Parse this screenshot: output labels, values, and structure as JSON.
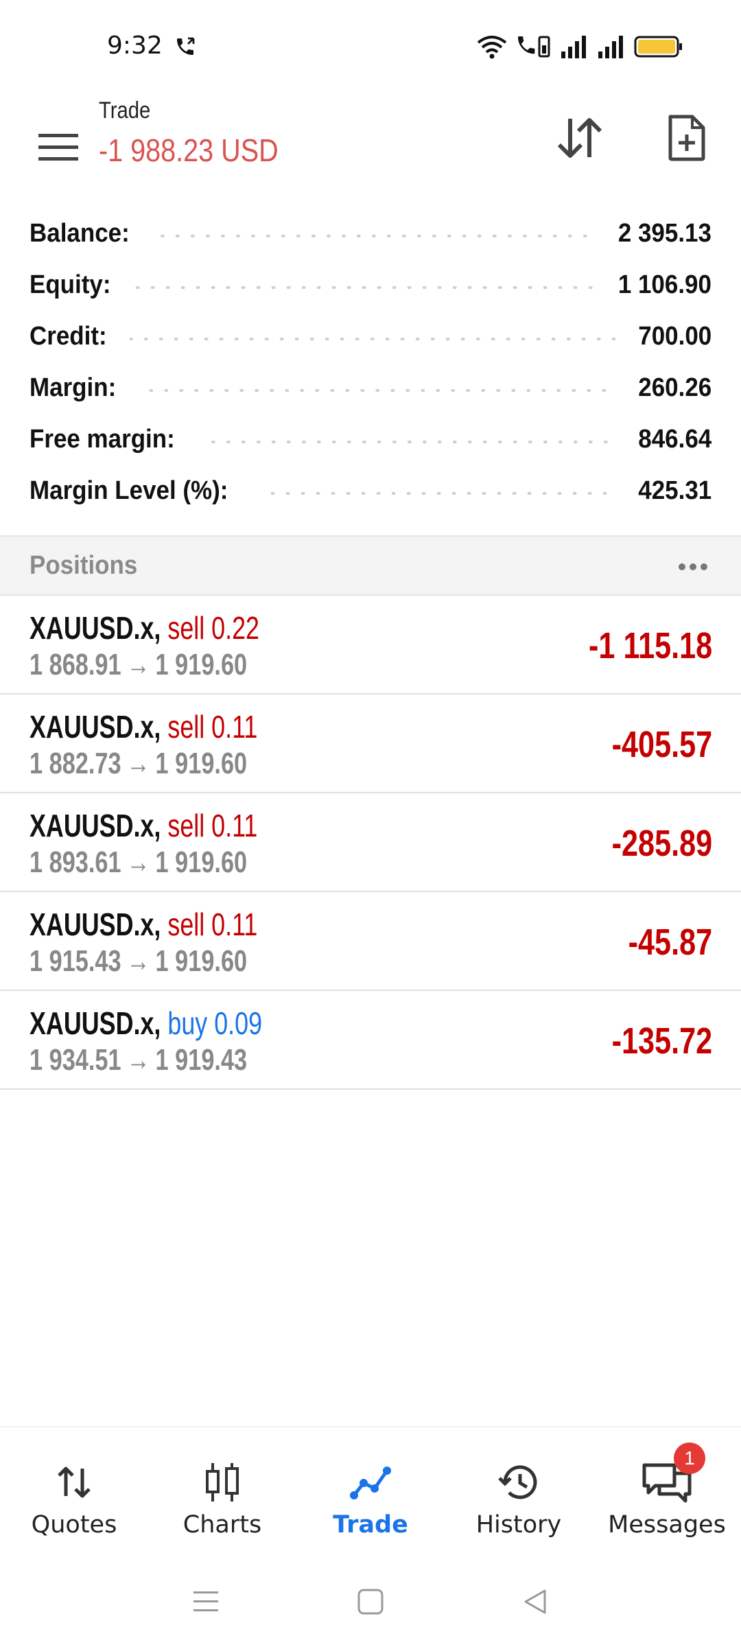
{
  "status_bar": {
    "time": "9:32"
  },
  "header": {
    "title": "Trade",
    "total_pl": "-1 988.23 USD"
  },
  "account_summary": [
    {
      "label": "Balance:",
      "value": "2 395.13"
    },
    {
      "label": "Equity:",
      "value": "1 106.90"
    },
    {
      "label": "Credit:",
      "value": "700.00"
    },
    {
      "label": "Margin:",
      "value": "260.26"
    },
    {
      "label": "Free margin:",
      "value": "846.64"
    },
    {
      "label": "Margin Level (%):",
      "value": "425.31"
    }
  ],
  "positions": {
    "title": "Positions",
    "arrow": "→",
    "items": [
      {
        "symbol": "XAUUSD.x,",
        "side": "sell 0.22",
        "open": "1 868.91",
        "current": "1 919.60",
        "profit": "-1 115.18"
      },
      {
        "symbol": "XAUUSD.x,",
        "side": "sell 0.11",
        "open": "1 882.73",
        "current": "1 919.60",
        "profit": "-405.57"
      },
      {
        "symbol": "XAUUSD.x,",
        "side": "sell 0.11",
        "open": "1 893.61",
        "current": "1 919.60",
        "profit": "-285.89"
      },
      {
        "symbol": "XAUUSD.x,",
        "side": "sell 0.11",
        "open": "1 915.43",
        "current": "1 919.60",
        "profit": "-45.87"
      },
      {
        "symbol": "XAUUSD.x,",
        "side": "buy 0.09",
        "open": "1 934.51",
        "current": "1 919.43",
        "profit": "-135.72"
      }
    ]
  },
  "bottom_nav": {
    "items": [
      {
        "label": "Quotes",
        "icon": "quotes-icon"
      },
      {
        "label": "Charts",
        "icon": "charts-icon"
      },
      {
        "label": "Trade",
        "icon": "trade-icon"
      },
      {
        "label": "History",
        "icon": "history-icon"
      },
      {
        "label": "Messages",
        "icon": "messages-icon"
      }
    ],
    "messages_badge": "1"
  },
  "colors": {
    "accent": "#1a73e8",
    "loss": "#c40000",
    "header_loss": "#d9534f",
    "battery": "#f5c53a"
  }
}
